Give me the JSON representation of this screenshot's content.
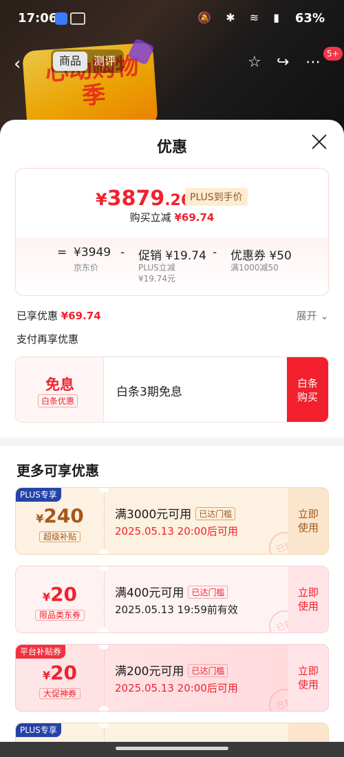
{
  "status_bar": {
    "time": "17:06",
    "icons": "🔕 ✱ ≋ ▮",
    "battery": "63%"
  },
  "nav": {
    "tabs": [
      {
        "label": "商品"
      },
      {
        "label": "测评"
      }
    ],
    "badge": "5+"
  },
  "background": {
    "banner_text": "心动购物季"
  },
  "sheet": {
    "title": "优惠",
    "price": {
      "currency": "¥",
      "int": "3879",
      "dec": ".26",
      "tag": "PLUS到手价"
    },
    "cut": {
      "label": "购买立减",
      "amount": "¥69.74"
    },
    "formula": {
      "eq": "=",
      "base": "¥3949",
      "base_label": "京东价",
      "minus1": "-",
      "promo": "促销 ¥19.74",
      "promo_sub1": "PLUS立减",
      "promo_sub2": "¥19.74元",
      "minus2": "-",
      "coupon": "优惠券 ¥50",
      "coupon_sub": "满1000减50"
    },
    "enjoyed": {
      "label": "已享优惠",
      "amount": "¥69.74"
    },
    "expand": "展开 ⌄",
    "pay_title": "支付再享优惠",
    "pay_card": {
      "big": "免息",
      "small": "白条优惠",
      "desc": "白条3期免息",
      "btn_line1": "白条",
      "btn_line2": "购买"
    },
    "more_title": "更多可享优惠",
    "coupons": [
      {
        "ribbon": "PLUS专享",
        "cur": "¥",
        "num": "240",
        "tag": "超级补贴",
        "cond": "满3000元可用",
        "reached": "已达门槛",
        "valid": "2025.05.13 20:00后可用",
        "use1": "立即",
        "use2": "使用",
        "stamp": "已领"
      },
      {
        "ribbon": "",
        "cur": "¥",
        "num": "20",
        "tag": "限品类东券",
        "cond": "满400元可用",
        "reached": "已达门槛",
        "valid": "2025.05.13 19:59前有效",
        "use1": "立即",
        "use2": "使用",
        "stamp": "已领"
      },
      {
        "ribbon": "平台补贴券",
        "cur": "¥",
        "num": "20",
        "tag": "大促神券",
        "cond": "满200元可用",
        "reached": "已达门槛",
        "valid": "2025.05.13 20:00后可用",
        "use1": "立即",
        "use2": "使用",
        "stamp": "已领"
      },
      {
        "ribbon": "PLUS专享"
      }
    ]
  }
}
